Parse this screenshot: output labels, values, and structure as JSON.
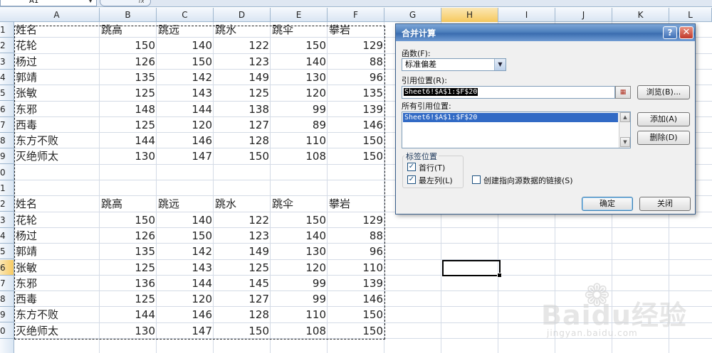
{
  "formula_bar": {
    "name_box": "A1",
    "fx_label": "fx"
  },
  "columns": [
    "A",
    "B",
    "C",
    "D",
    "E",
    "F",
    "G",
    "H",
    "I",
    "J",
    "K",
    "L"
  ],
  "selected_column": "H",
  "rows": [
    "1",
    "2",
    "3",
    "4",
    "5",
    "6",
    "7",
    "8",
    "9",
    "0",
    "1",
    "2",
    "3",
    "4",
    "5",
    "6",
    "7",
    "8",
    "9",
    "0"
  ],
  "selected_row_index": 15,
  "table1": {
    "header": [
      "姓名",
      "跳高",
      "跳远",
      "跳水",
      "跳伞",
      "攀岩"
    ],
    "rows": [
      [
        "花轮",
        "150",
        "140",
        "122",
        "150",
        "129"
      ],
      [
        "杨过",
        "126",
        "150",
        "123",
        "140",
        "88"
      ],
      [
        "郭靖",
        "135",
        "142",
        "149",
        "130",
        "96"
      ],
      [
        "张敏",
        "125",
        "143",
        "125",
        "120",
        "135"
      ],
      [
        "东邪",
        "148",
        "144",
        "138",
        "99",
        "139"
      ],
      [
        "西毒",
        "125",
        "120",
        "127",
        "89",
        "146"
      ],
      [
        "东方不败",
        "144",
        "146",
        "128",
        "110",
        "150"
      ],
      [
        "灭绝师太",
        "130",
        "147",
        "150",
        "108",
        "150"
      ]
    ]
  },
  "table2": {
    "header": [
      "姓名",
      "跳高",
      "跳远",
      "跳水",
      "跳伞",
      "攀岩"
    ],
    "rows": [
      [
        "花轮",
        "150",
        "140",
        "122",
        "150",
        "129"
      ],
      [
        "杨过",
        "126",
        "150",
        "123",
        "140",
        "88"
      ],
      [
        "郭靖",
        "135",
        "142",
        "149",
        "130",
        "96"
      ],
      [
        "张敏",
        "125",
        "143",
        "125",
        "120",
        "110"
      ],
      [
        "东邪",
        "136",
        "144",
        "145",
        "99",
        "139"
      ],
      [
        "西毒",
        "125",
        "120",
        "127",
        "99",
        "146"
      ],
      [
        "东方不败",
        "144",
        "146",
        "128",
        "110",
        "150"
      ],
      [
        "灭绝师太",
        "130",
        "147",
        "150",
        "108",
        "150"
      ]
    ]
  },
  "dialog": {
    "title": "合并计算",
    "help": "?",
    "close": "✕",
    "function_label": "函数(F):",
    "function_value": "标准偏差",
    "ref_label": "引用位置(R):",
    "ref_value": "Sheet6!$A$1:$F$20",
    "browse_button": "浏览(B)...",
    "all_refs_label": "所有引用位置:",
    "all_refs_items": [
      "Sheet6!$A$1:$F$20"
    ],
    "add_button": "添加(A)",
    "delete_button": "删除(D)",
    "group_label": "标签位置",
    "top_row_label": "首行(T)",
    "top_row_checked": true,
    "left_col_label": "最左列(L)",
    "left_col_checked": true,
    "link_label": "创建指向源数据的链接(S)",
    "link_checked": false,
    "ok_button": "确定",
    "cancel_button": "关闭"
  },
  "watermark": {
    "brand": "Baidu经验",
    "url": "jingyan.baidu.com"
  }
}
